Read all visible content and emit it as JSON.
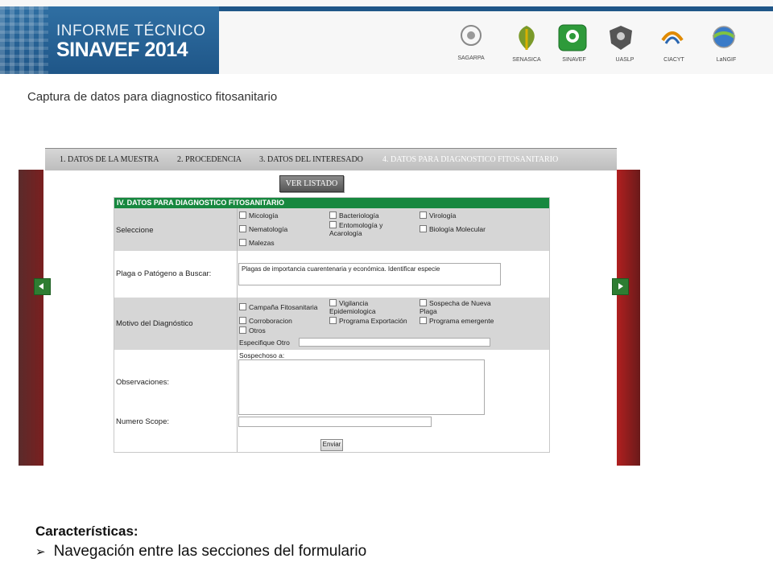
{
  "header": {
    "brand_line1": "INFORME TÉCNICO",
    "brand_line2": "SINAVEF 2014",
    "logos": [
      {
        "name": "sagarpa",
        "label": "SAGARPA"
      },
      {
        "name": "senasica",
        "label": "SENASICA"
      },
      {
        "name": "sinavef",
        "label": "SINAVEF"
      },
      {
        "name": "uaslp",
        "label": "UASLP"
      },
      {
        "name": "ciacyt",
        "label": "CIACYT"
      },
      {
        "name": "langif",
        "label": "LaNGIF"
      }
    ]
  },
  "subtitle": "Captura de datos para diagnostico fitosanitario",
  "form": {
    "tabs": [
      "1. DATOS DE LA MUESTRA",
      "2. PROCEDENCIA",
      "3. DATOS DEL INTERESADO",
      "4. DATOS PARA DIAGNOSTICO FITOSANITARIO"
    ],
    "active_tab": 3,
    "list_button": "VER LISTADO",
    "section_title": "IV. DATOS PARA DIAGNOSTICO FITOSANITARIO",
    "seleccione_label": "Seleccione",
    "seleccione_options": [
      "Micología",
      "Bacteriología",
      "Virología",
      "Nematología",
      "Entomología y Acarología",
      "Biología Molecular",
      "Malezas"
    ],
    "plaga_label": "Plaga o Patógeno a Buscar:",
    "plaga_value": "Plagas de importancia cuarentenaria y económica. Identificar especie",
    "motivo_label": "Motivo del Diagnóstico",
    "motivo_options": [
      "Campaña Fitosanitaria",
      "Vigilancia Epidemiologica",
      "Sospecha de Nueva Plaga",
      "Corroboracion",
      "Programa Exportación",
      "Programa emergente",
      "Otros"
    ],
    "especifique_label": "Especifique Otro",
    "observaciones_label": "Observaciones:",
    "observaciones_value": "Sospechoso a:",
    "scope_label": "Numero Scope:",
    "submit_label": "Enviar"
  },
  "features": {
    "title": "Características:",
    "items": [
      "Navegación entre las secciones del formulario"
    ]
  }
}
